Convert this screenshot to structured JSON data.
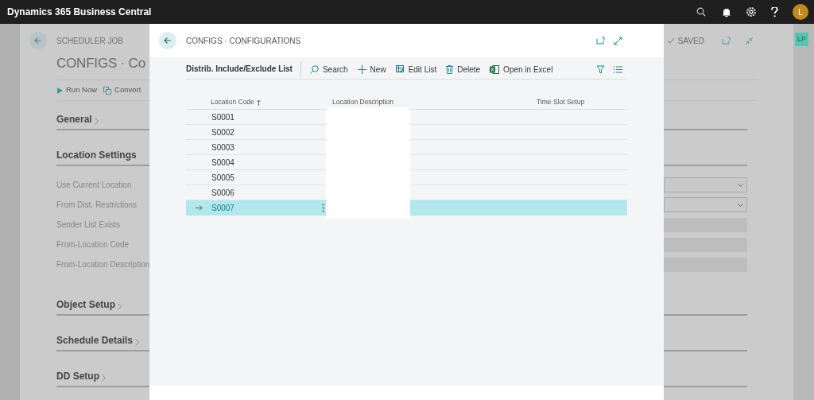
{
  "app_bar": {
    "title": "Dynamics 365 Business Central",
    "avatar_initial": "L"
  },
  "background_page": {
    "breadcrumb": "SCHEDULER JOB",
    "title": "CONFIGS · Co",
    "status": "SAVED",
    "user_badge": "LP",
    "actions": [
      {
        "label": "Run Now",
        "kind": "run"
      },
      {
        "label": "Convert",
        "kind": "convert"
      }
    ],
    "sections": [
      {
        "title": "General",
        "expanded": false
      },
      {
        "title": "Location Settings",
        "expanded": true,
        "fields": [
          {
            "label": "Use Current Location",
            "kind": "dropdown"
          },
          {
            "label": "From Dist. Restrictions",
            "kind": "dropdown"
          },
          {
            "label": "Sender List Exists",
            "kind": "readonly"
          },
          {
            "label": "From-Location Code",
            "kind": "readonly"
          },
          {
            "label": "From-Location Description",
            "kind": "readonly"
          }
        ]
      },
      {
        "title": "Object Setup",
        "expanded": false
      },
      {
        "title": "Schedule Details",
        "expanded": false
      },
      {
        "title": "DD Setup",
        "expanded": false
      }
    ]
  },
  "modal": {
    "title": "CONFIGS · CONFIGURATIONS",
    "list_title": "Distrib. Include/Exclude List",
    "actions": [
      {
        "label": "Search",
        "kind": "search"
      },
      {
        "label": "New",
        "kind": "new"
      },
      {
        "label": "Edit List",
        "kind": "edit"
      },
      {
        "label": "Delete",
        "kind": "delete"
      },
      {
        "label": "Open in Excel",
        "kind": "excel"
      }
    ],
    "columns": [
      {
        "label": "Location Code",
        "sorted": true
      },
      {
        "label": "Location Description",
        "sorted": false
      },
      {
        "label": "Time Slot Setup",
        "sorted": false
      }
    ],
    "rows": [
      {
        "location_code": "S0001",
        "selected": false
      },
      {
        "location_code": "S0002",
        "selected": false
      },
      {
        "location_code": "S0003",
        "selected": false
      },
      {
        "location_code": "S0004",
        "selected": false
      },
      {
        "location_code": "S0005",
        "selected": false
      },
      {
        "location_code": "S0006",
        "selected": false
      },
      {
        "location_code": "S0007",
        "selected": true
      }
    ]
  }
}
